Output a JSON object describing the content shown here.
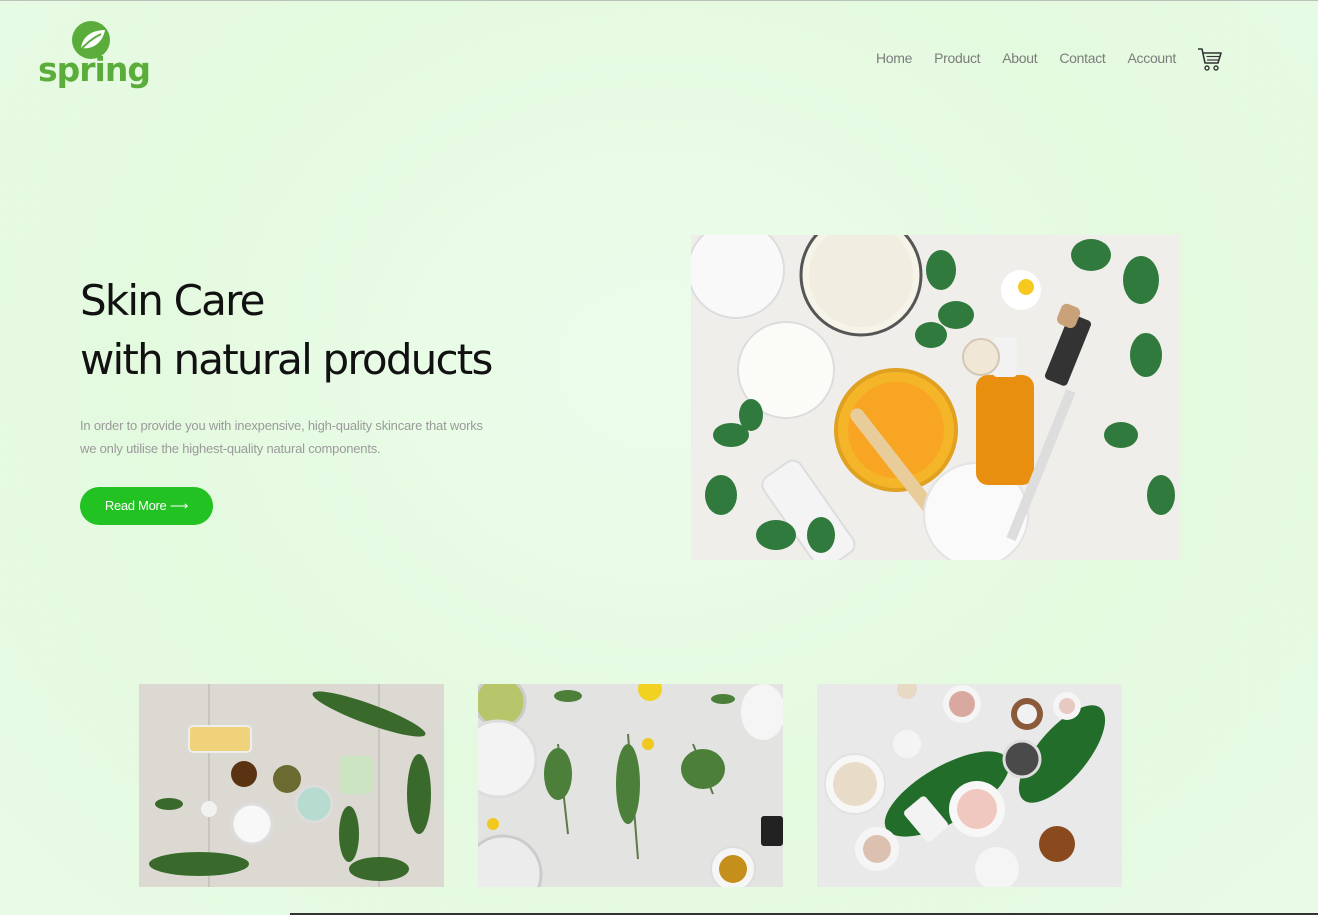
{
  "brand": {
    "name": "spring"
  },
  "nav": {
    "items": [
      {
        "label": "Home"
      },
      {
        "label": "Product"
      },
      {
        "label": "About"
      },
      {
        "label": "Contact"
      },
      {
        "label": "Account"
      }
    ],
    "cart_icon": "shopping-cart-icon"
  },
  "hero": {
    "title_line1": "Skin Care",
    "title_line2": "with natural products",
    "desc_line1": "In order to provide you with inexpensive, high-quality skincare that works",
    "desc_line2": "we only utilise the highest-quality natural components.",
    "button_label": "Read More ⟶"
  },
  "colors": {
    "accent": "#21c221",
    "logo": "#5aad3b",
    "background": "#e4fadf"
  }
}
